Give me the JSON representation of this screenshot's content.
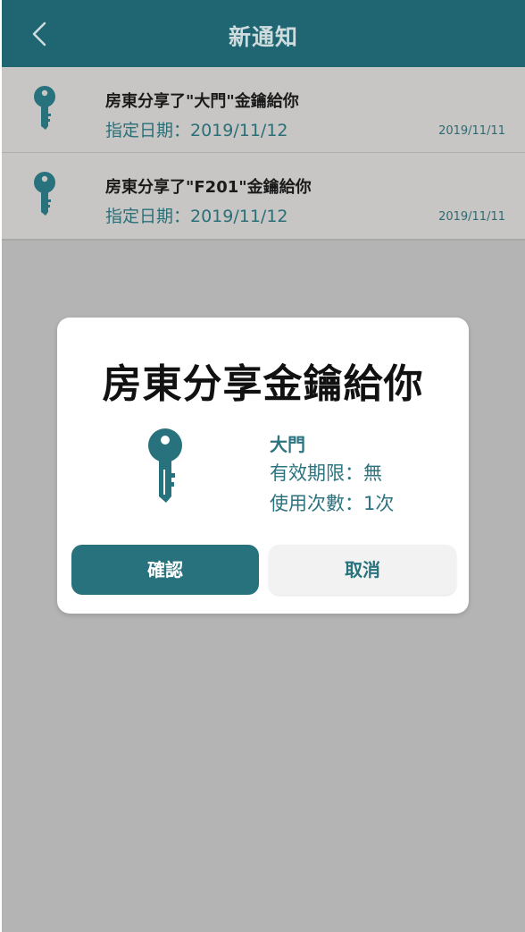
{
  "header": {
    "title": "新通知",
    "back_icon": "chevron-left-icon"
  },
  "notifications": [
    {
      "title": "房東分享了\"大門\"金鑰給你",
      "date": "指定日期：2019/11/12",
      "time": "2019/11/11",
      "icon": "key-icon"
    },
    {
      "title": "房東分享了\"F201\"金鑰給你",
      "date": "指定日期：2019/11/12",
      "time": "2019/11/11",
      "icon": "key-icon"
    }
  ],
  "modal": {
    "title": "房東分享金鑰給你",
    "icon": "key-icon",
    "key_name": "大門",
    "validity": "有效期限：無",
    "usage": "使用次數：1次",
    "confirm_label": "確認",
    "cancel_label": "取消"
  },
  "colors": {
    "header_bg": "#1f6672",
    "accent": "#27727c",
    "overlay": "#b4b4b4",
    "list_bg": "#c8c6c4"
  }
}
